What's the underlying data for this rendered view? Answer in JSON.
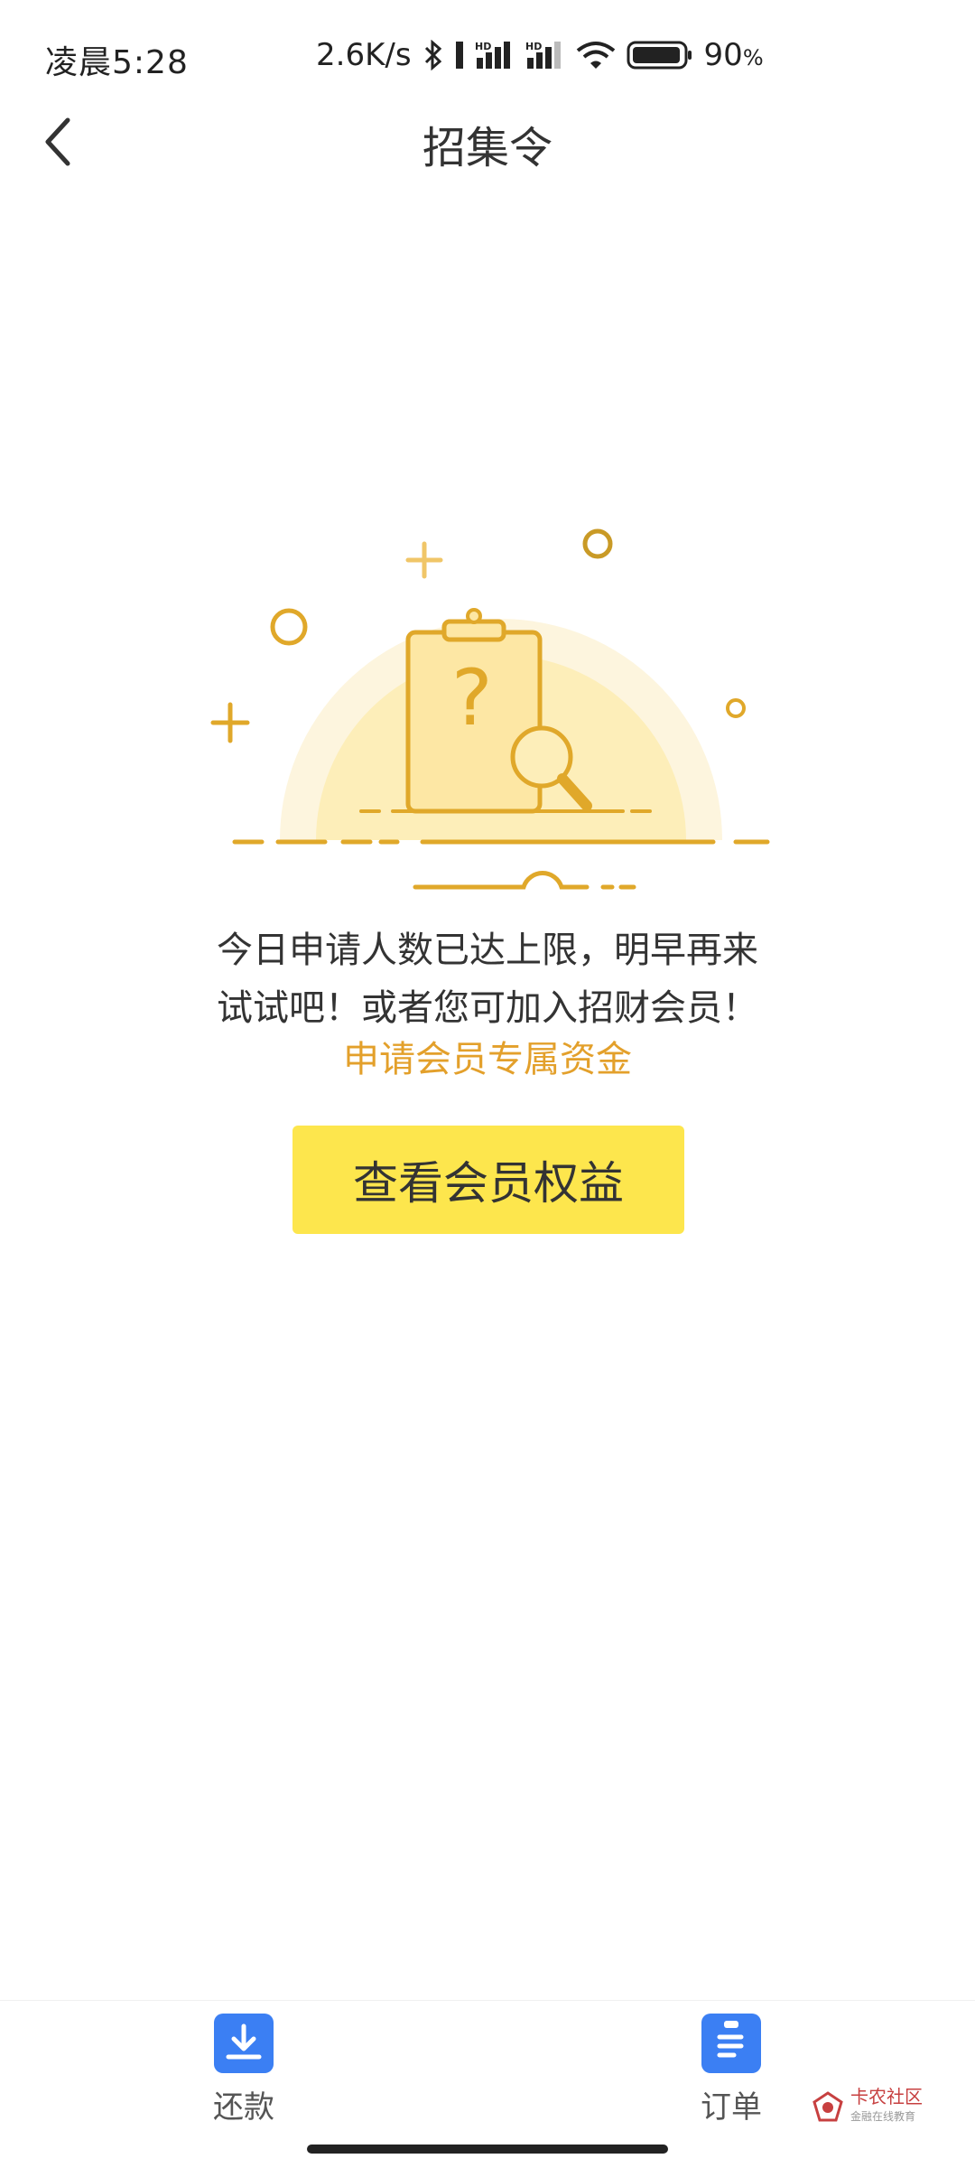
{
  "status_bar": {
    "time": "凌晨5:28",
    "network_speed": "2.6K/s",
    "battery": "90",
    "battery_unit": "%",
    "icons": [
      "bluetooth-icon",
      "signal-hd-icon",
      "signal-hd-icon",
      "wifi-icon",
      "battery-icon"
    ]
  },
  "header": {
    "title": "招集令",
    "back_icon": "chevron-left-icon"
  },
  "main": {
    "illustration": "clipboard-question-search-icon",
    "message_line1": "今日申请人数已达上限，明早再来",
    "message_line2": "试试吧！或者您可加入招财会员！",
    "member_link": "申请会员专属资金",
    "cta_button": "查看会员权益"
  },
  "colors": {
    "accent_yellow": "#fde64d",
    "link_orange": "#e3a02b",
    "nav_blue": "#3b7ff3",
    "illustration_gold": "#e0a82a"
  },
  "bottom_nav": {
    "items": [
      {
        "label": "还款",
        "icon": "download-icon"
      },
      {
        "label": "订单",
        "icon": "document-list-icon"
      }
    ]
  },
  "watermark": {
    "text": "卡农社区",
    "sub": "金融在线教育"
  }
}
